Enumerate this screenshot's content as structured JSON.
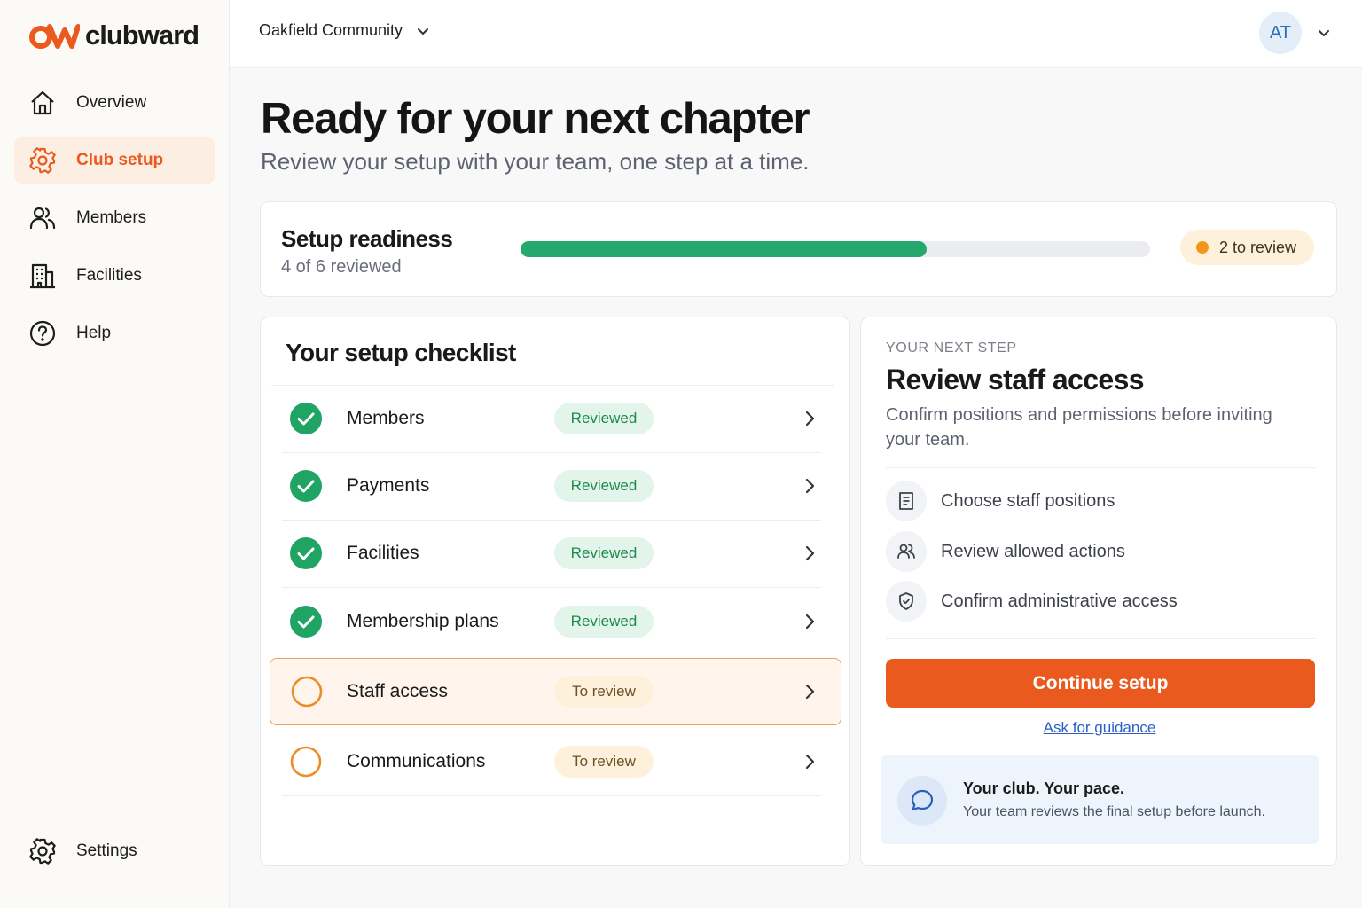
{
  "brand": {
    "name": "clubward",
    "accent": "#ea5a1e"
  },
  "sidebar": {
    "items": [
      {
        "label": "Overview",
        "icon": "home-icon",
        "active": false
      },
      {
        "label": "Club setup",
        "icon": "gear-icon",
        "active": true
      },
      {
        "label": "Members",
        "icon": "users-icon",
        "active": false
      },
      {
        "label": "Facilities",
        "icon": "building-icon",
        "active": false
      },
      {
        "label": "Help",
        "icon": "help-circle-icon",
        "active": false
      }
    ],
    "settings": {
      "label": "Settings",
      "icon": "gear-icon"
    }
  },
  "topbar": {
    "community": "Oakfield Community",
    "avatar_initials": "AT"
  },
  "header": {
    "title": "Ready for your next chapter",
    "subtitle": "Review your setup with your team, one step at a time."
  },
  "readiness": {
    "title": "Setup readiness",
    "subtitle": "4 of 6 reviewed",
    "progress_fraction": 0.645,
    "badge": "2 to review",
    "progress_color": "#25a86d"
  },
  "checklist": {
    "title": "Your setup checklist",
    "items": [
      {
        "label": "Members",
        "status": "Reviewed",
        "done": true
      },
      {
        "label": "Payments",
        "status": "Reviewed",
        "done": true
      },
      {
        "label": "Facilities",
        "status": "Reviewed",
        "done": true
      },
      {
        "label": "Membership plans",
        "status": "Reviewed",
        "done": true
      },
      {
        "label": "Staff access",
        "status": "To review",
        "done": false,
        "current": true
      },
      {
        "label": "Communications",
        "status": "To review",
        "done": false
      }
    ]
  },
  "next_step": {
    "eyebrow": "YOUR NEXT STEP",
    "title": "Review staff access",
    "description": "Confirm positions and permissions before inviting your team.",
    "steps": [
      {
        "label": "Choose staff positions",
        "icon": "document-icon"
      },
      {
        "label": "Review allowed actions",
        "icon": "users-icon"
      },
      {
        "label": "Confirm administrative access",
        "icon": "shield-icon"
      }
    ],
    "cta": "Continue setup",
    "guidance_link": "Ask for guidance",
    "note": {
      "title": "Your club. Your pace.",
      "text": "Your team reviews the final setup before launch.",
      "icon": "chat-bubble-icon"
    }
  }
}
